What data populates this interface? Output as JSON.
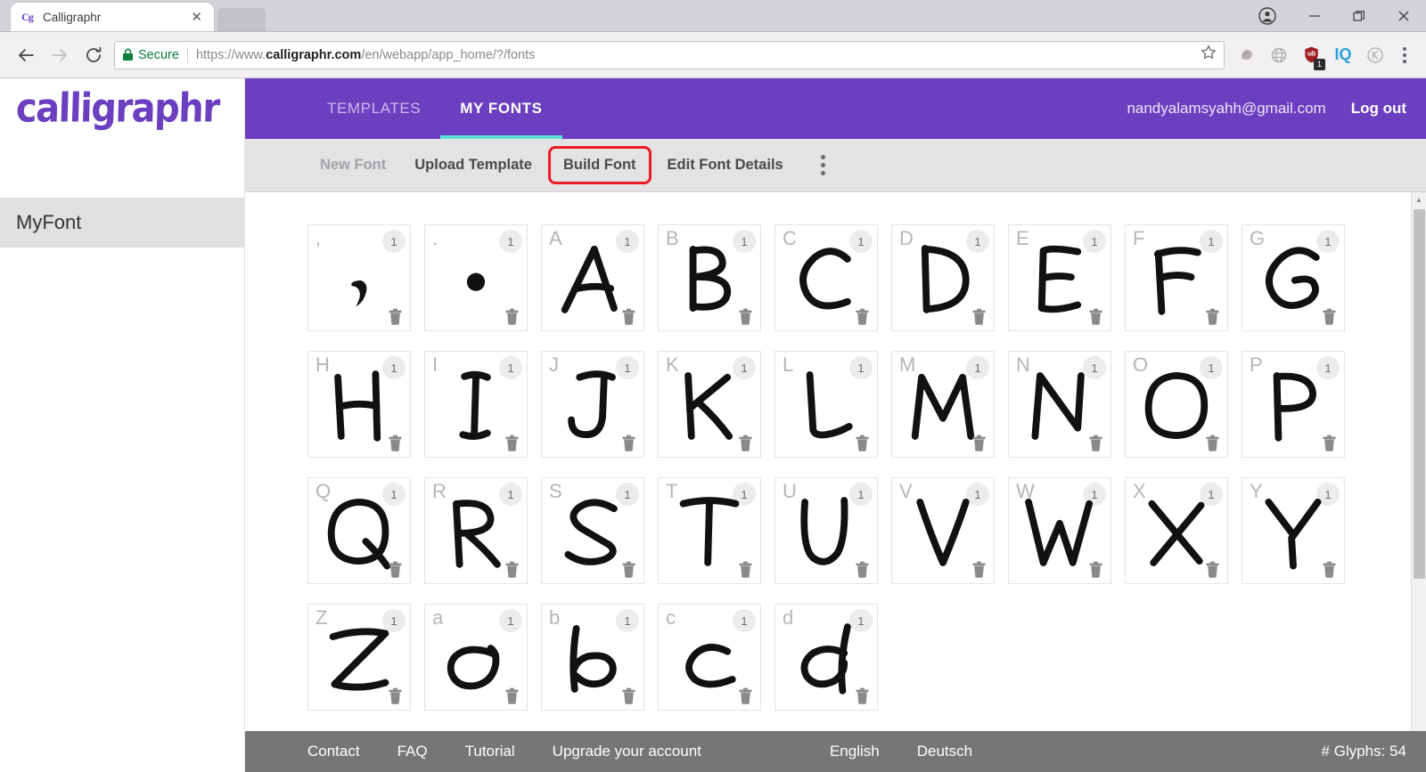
{
  "browser": {
    "tab": {
      "title": "Calligraphr",
      "favicon": "Cg",
      "close_icon": "close-icon"
    },
    "window_controls": {
      "profile": "profile-icon",
      "minimize": "minimize-icon",
      "restore": "restore-icon",
      "close": "close-icon"
    },
    "nav": {
      "back": "back-arrow-icon",
      "forward": "forward-arrow-icon",
      "reload": "reload-icon"
    },
    "omnibox": {
      "security_label": "Secure",
      "lock_icon": "lock-icon",
      "url_scheme": "https://www.",
      "url_domain": "calligraphr.com",
      "url_path": "/en/webapp/app_home/?/fonts",
      "bookmark_icon": "star-icon"
    },
    "extensions": [
      {
        "name": "globe-shape-icon",
        "badge": ""
      },
      {
        "name": "globe-icon",
        "badge": ""
      },
      {
        "name": "ublock-origin-icon",
        "badge": "1"
      },
      {
        "name": "iq-icon",
        "label": "IQ",
        "badge": ""
      },
      {
        "name": "kaspersky-icon",
        "badge": ""
      }
    ],
    "menu_icon": "chrome-menu-icon"
  },
  "app": {
    "logo": "calligraphr",
    "nav_tabs": [
      {
        "label": "TEMPLATES",
        "active": false
      },
      {
        "label": "MY FONTS",
        "active": true
      }
    ],
    "account_email": "nandyalamsyahh@gmail.com",
    "logout_label": "Log out",
    "toolbar": [
      {
        "label": "New Font",
        "disabled": true,
        "highlighted": false
      },
      {
        "label": "Upload Template",
        "disabled": false,
        "highlighted": false
      },
      {
        "label": "Build Font",
        "disabled": false,
        "highlighted": true
      },
      {
        "label": "Edit Font Details",
        "disabled": false,
        "highlighted": false
      }
    ],
    "toolbar_overflow_icon": "more-vertical-icon",
    "sidebar": {
      "items": [
        {
          "label": "MyFont",
          "selected": true
        }
      ]
    },
    "glyphs": [
      {
        "char": ",",
        "count": "1",
        "shape": "comma"
      },
      {
        "char": ".",
        "count": "1",
        "shape": "period"
      },
      {
        "char": "A",
        "count": "1",
        "shape": "A"
      },
      {
        "char": "B",
        "count": "1",
        "shape": "B"
      },
      {
        "char": "C",
        "count": "1",
        "shape": "C"
      },
      {
        "char": "D",
        "count": "1",
        "shape": "D"
      },
      {
        "char": "E",
        "count": "1",
        "shape": "E"
      },
      {
        "char": "F",
        "count": "1",
        "shape": "F"
      },
      {
        "char": "G",
        "count": "1",
        "shape": "G"
      },
      {
        "char": "H",
        "count": "1",
        "shape": "H"
      },
      {
        "char": "I",
        "count": "1",
        "shape": "I"
      },
      {
        "char": "J",
        "count": "1",
        "shape": "J"
      },
      {
        "char": "K",
        "count": "1",
        "shape": "K"
      },
      {
        "char": "L",
        "count": "1",
        "shape": "L"
      },
      {
        "char": "M",
        "count": "1",
        "shape": "M"
      },
      {
        "char": "N",
        "count": "1",
        "shape": "N"
      },
      {
        "char": "O",
        "count": "1",
        "shape": "O"
      },
      {
        "char": "P",
        "count": "1",
        "shape": "P"
      },
      {
        "char": "Q",
        "count": "1",
        "shape": "Q"
      },
      {
        "char": "R",
        "count": "1",
        "shape": "R"
      },
      {
        "char": "S",
        "count": "1",
        "shape": "S"
      },
      {
        "char": "T",
        "count": "1",
        "shape": "T"
      },
      {
        "char": "U",
        "count": "1",
        "shape": "U"
      },
      {
        "char": "V",
        "count": "1",
        "shape": "V"
      },
      {
        "char": "W",
        "count": "1",
        "shape": "W"
      },
      {
        "char": "X",
        "count": "1",
        "shape": "X"
      },
      {
        "char": "Y",
        "count": "1",
        "shape": "Y"
      },
      {
        "char": "Z",
        "count": "1",
        "shape": "Z"
      },
      {
        "char": "a",
        "count": "1",
        "shape": "a"
      },
      {
        "char": "b",
        "count": "1",
        "shape": "b"
      },
      {
        "char": "c",
        "count": "1",
        "shape": "c"
      },
      {
        "char": "d",
        "count": "1",
        "shape": "d"
      }
    ],
    "glyph_delete_icon": "trash-icon",
    "footer": {
      "links": [
        "Contact",
        "FAQ",
        "Tutorial",
        "Upgrade your account"
      ],
      "languages": [
        "English",
        "Deutsch"
      ],
      "glyph_count_label": "# Glyphs: 54"
    }
  },
  "colors": {
    "brand_purple": "#6b3fbf",
    "accent_teal": "#5fe2d6",
    "highlight_red": "#ee1b24",
    "footer_gray": "#767676"
  }
}
